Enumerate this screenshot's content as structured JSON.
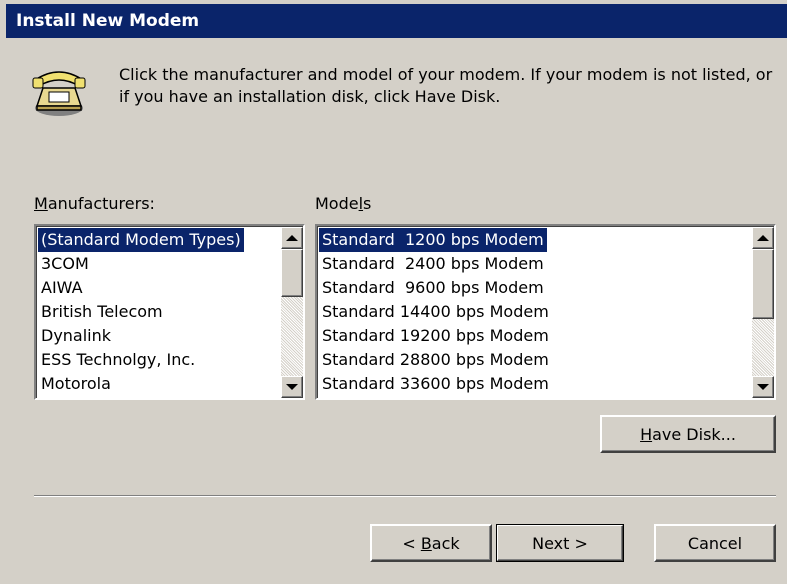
{
  "window": {
    "title": "Install New Modem"
  },
  "icon": "telephone-modem-icon",
  "instructions": "Click the manufacturer and model of your modem. If your modem is not listed, or if you have an installation disk, click Have Disk.",
  "manufacturers": {
    "label_pre": "",
    "label_mnemonic": "M",
    "label_post": "anufacturers:",
    "items": [
      "(Standard Modem Types)",
      "3COM",
      "AIWA",
      "British Telecom",
      "Dynalink",
      "ESS Technolgy, Inc.",
      "Motorola"
    ],
    "selected_index": 0
  },
  "models": {
    "label_pre": "Mode",
    "label_mnemonic": "l",
    "label_post": "s",
    "items": [
      "Standard  1200 bps Modem",
      "Standard  2400 bps Modem",
      "Standard  9600 bps Modem",
      "Standard 14400 bps Modem",
      "Standard 19200 bps Modem",
      "Standard 28800 bps Modem",
      "Standard 33600 bps Modem"
    ],
    "selected_index": 0
  },
  "buttons": {
    "have_disk_mnemonic": "H",
    "have_disk_post": "ave Disk...",
    "back_pre": "< ",
    "back_mnemonic": "B",
    "back_post": "ack",
    "next": "Next >",
    "cancel": "Cancel"
  },
  "colors": {
    "face": "#d4d0c8",
    "titlebar": "#0a246a",
    "selection": "#0a246a"
  }
}
